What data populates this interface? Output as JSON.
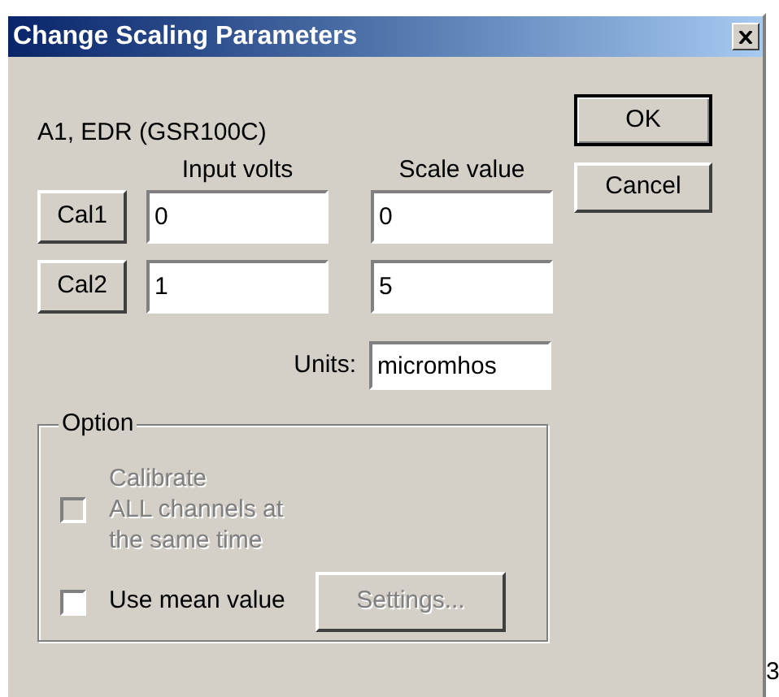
{
  "window": {
    "title": "Change Scaling Parameters"
  },
  "channel_label": "A1, EDR (GSR100C)",
  "columns": [
    "Input volts",
    "Scale value"
  ],
  "calibration_rows": [
    {
      "button": "Cal1",
      "input_volts": "0",
      "scale_value": "0"
    },
    {
      "button": "Cal2",
      "input_volts": "1",
      "scale_value": "5"
    }
  ],
  "units": {
    "label": "Units:",
    "value": "micromhos"
  },
  "buttons": [
    {
      "label": "OK",
      "default": true
    },
    {
      "label": "Cancel",
      "default": false
    }
  ],
  "option_group": {
    "title": "Option",
    "calibrate_all": {
      "label_lines": [
        "Calibrate",
        "ALL channels at",
        "the same time"
      ],
      "checked": false,
      "disabled": true
    },
    "use_mean": {
      "label": "Use mean value",
      "checked": false,
      "disabled": false
    },
    "settings_button": {
      "label": "Settings...",
      "disabled": true
    }
  },
  "edge_text": "3"
}
